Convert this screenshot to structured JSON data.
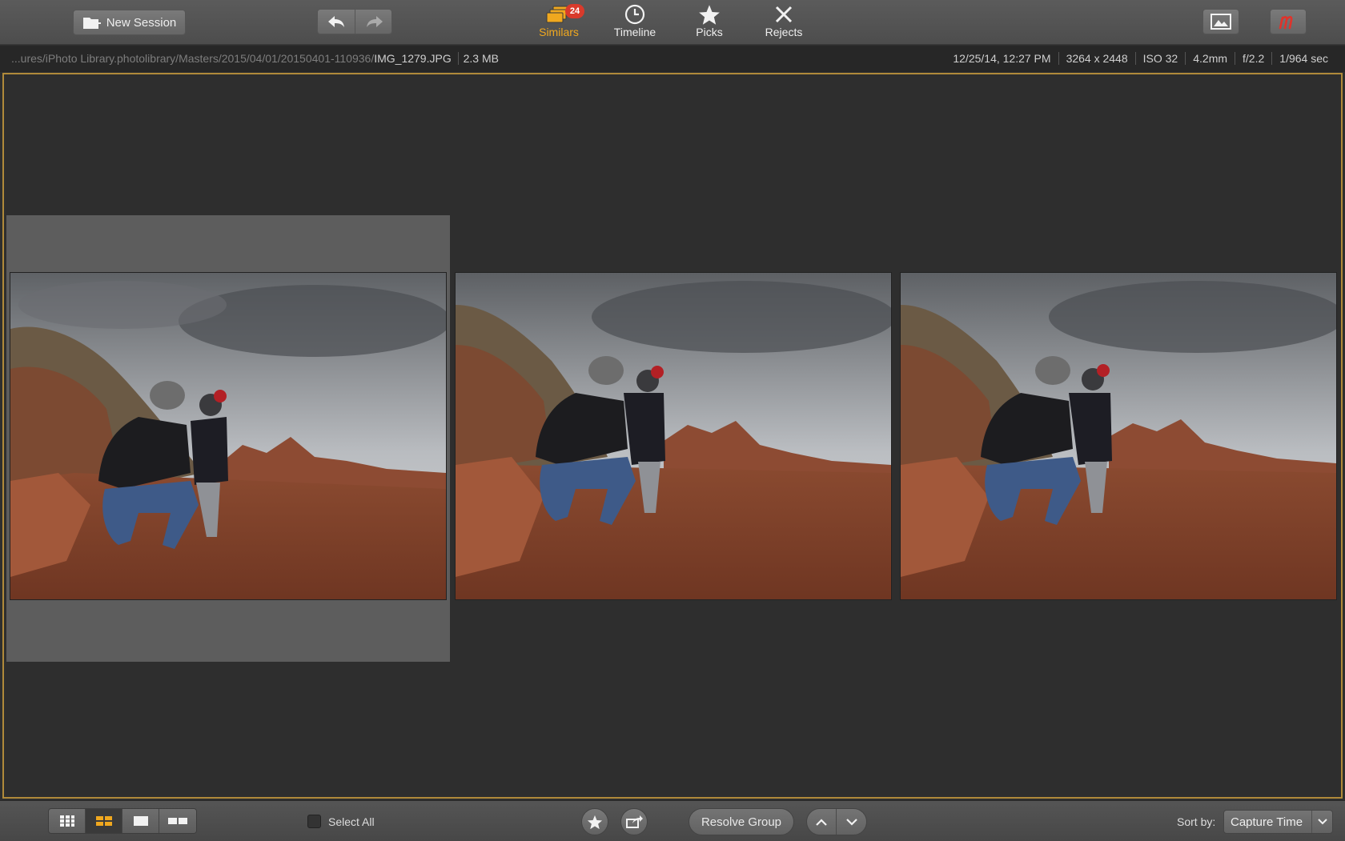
{
  "toolbar": {
    "new_session_label": "New Session",
    "tabs": [
      {
        "label": "Similars",
        "badge": "24",
        "active": true
      },
      {
        "label": "Timeline"
      },
      {
        "label": "Picks"
      },
      {
        "label": "Rejects"
      }
    ]
  },
  "infobar": {
    "path_prefix": "...ures/iPhoto Library.photolibrary/Masters/2015/04/01/20150401-110936/",
    "filename": "IMG_1279.JPG",
    "filesize": "2.3 MB",
    "date": "12/25/14, 12:27 PM",
    "dimensions": "3264 x 2448",
    "iso": "ISO 32",
    "focal": "4.2mm",
    "aperture": "f/2.2",
    "shutter": "1/964 sec"
  },
  "photos": [
    {
      "selected": true
    },
    {
      "selected": false
    },
    {
      "selected": false
    }
  ],
  "bottombar": {
    "select_all_label": "Select All",
    "resolve_label": "Resolve Group",
    "sort_label": "Sort by:",
    "sort_value": "Capture Time"
  },
  "colors": {
    "accent": "#f0a81f",
    "badge": "#d93a2b",
    "selection_border": "#b08a3a"
  }
}
